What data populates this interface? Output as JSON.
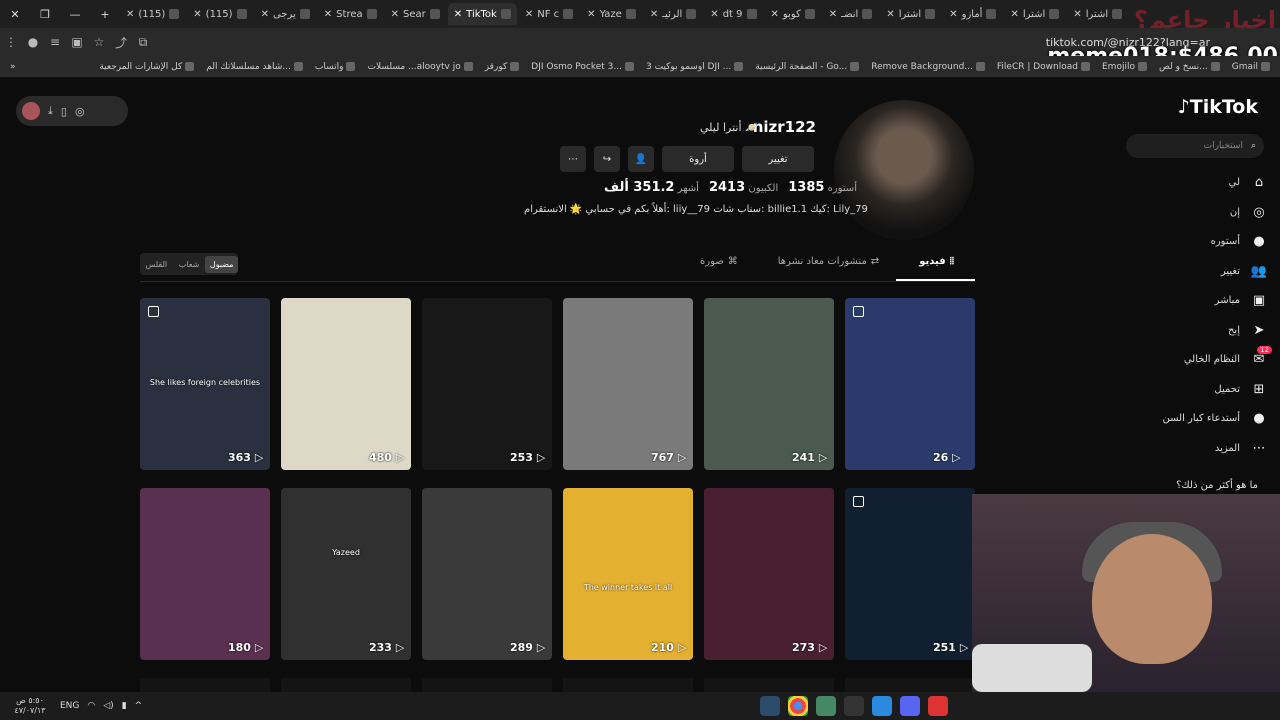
{
  "browser": {
    "tabs": [
      "(115)",
      "(115)",
      "يرجى",
      "Strea",
      "Sear",
      "TikTok",
      "NF c",
      "Yaze",
      "الرئيـ",
      "dt 9",
      "كوبو",
      "انضـ",
      "اشترا",
      "أمازو",
      "اشترا",
      "اشترا"
    ],
    "url": "tiktok.com/@nizr122?lang=ar",
    "bookmarks": [
      "Gmail",
      "نسخ و لص...",
      "Emojilo",
      "FileCR | Download",
      "Remove Background...",
      "الصفحة الرئيسية - Go...",
      "اوسمو بوكيت 3 DJI ...",
      "DJI Osmo Pocket 3...",
      "كورقز",
      "مسلسلات ...alooytv jo",
      "واتساب",
      "شاهد مسلسلاتك الم...",
      "كل الإشارات المرجعية"
    ]
  },
  "overlay": {
    "earnings": "meme018:$486.00",
    "watermark": "اخبار حاعم؟"
  },
  "tiktok": {
    "logo": "TikTok",
    "search_placeholder": "استخبارات",
    "nav": [
      {
        "label": "لي",
        "icon": "home-icon"
      },
      {
        "label": "إن",
        "icon": "compass-icon"
      },
      {
        "label": "أستوره",
        "icon": "avatar-icon"
      },
      {
        "label": "تغيير",
        "icon": "users-icon"
      },
      {
        "label": "مباشر",
        "icon": "live-icon"
      },
      {
        "label": "إبح",
        "icon": "send-icon"
      },
      {
        "label": "النظام الخالي",
        "icon": "inbox-icon",
        "badge": "12"
      },
      {
        "label": "تحميل",
        "icon": "upload-icon"
      },
      {
        "label": "أستدعاء كبار السن",
        "icon": "avatar-icon"
      },
      {
        "label": "المزيد",
        "icon": "more-icon"
      }
    ],
    "more_question": "ما هو أكثر من ذلك؟",
    "profile": {
      "username": "nizr122",
      "nickname": "أنترا ليلي 🪐",
      "buttons": {
        "edit": "تغيير",
        "gift": "أروة"
      },
      "stats": {
        "following_label": "أستوره",
        "following": "1385",
        "followers_label": "الكبيون",
        "followers": "2413",
        "likes_label": "أشهر",
        "likes": "351.2 ألف"
      },
      "bio": "أهلاً بكم في حسابي 🌟 الانستقرام: liiy__79 سناب شات: billie1.1 كيك: Lily_79"
    },
    "sort": [
      "مضبول",
      "شعاب",
      "القلس"
    ],
    "tabs": [
      {
        "label": "فيديو",
        "icon": "grid-icon"
      },
      {
        "label": "منشورات معاد نشرها",
        "icon": "repost-icon"
      },
      {
        "label": "صورة",
        "icon": "photo-icon"
      }
    ],
    "videos": [
      {
        "views": "363",
        "caption": "She likes foreign celebrities",
        "color": "#2a3040"
      },
      {
        "views": "480",
        "caption": "",
        "color": "#ddd8c8"
      },
      {
        "views": "253",
        "caption": "",
        "color": "#181818"
      },
      {
        "views": "767",
        "caption": "",
        "color": "#7a7a7a"
      },
      {
        "views": "241",
        "caption": "",
        "color": "#4a5a4f"
      },
      {
        "views": "26",
        "caption": "",
        "color": "#2a3a6a"
      },
      {
        "views": "180",
        "caption": "",
        "color": "#5a3050"
      },
      {
        "views": "233",
        "caption": "Yazeed",
        "color": "#303030"
      },
      {
        "views": "289",
        "caption": "",
        "color": "#3a3a3a"
      },
      {
        "views": "210",
        "caption": "The winner takes it all",
        "color": "#e4b030"
      },
      {
        "views": "273",
        "caption": "",
        "color": "#4a2030"
      },
      {
        "views": "251",
        "caption": "",
        "color": "#102030"
      }
    ]
  },
  "taskbar": {
    "time": "٥:٥٠ ص",
    "date": "٤٧/٠٧/١٣",
    "lang": "ENG"
  }
}
